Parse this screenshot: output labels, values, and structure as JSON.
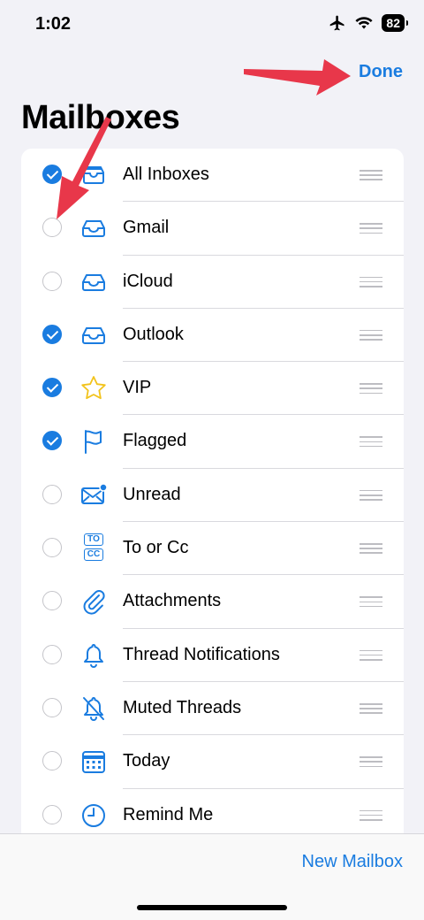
{
  "status_bar": {
    "time": "1:02",
    "battery": "82"
  },
  "header": {
    "done_label": "Done",
    "title": "Mailboxes"
  },
  "mailboxes": [
    {
      "label": "All Inboxes",
      "checked": true,
      "icon": "inbox-stack-icon"
    },
    {
      "label": "Gmail",
      "checked": false,
      "icon": "inbox-tray-icon"
    },
    {
      "label": "iCloud",
      "checked": false,
      "icon": "inbox-tray-icon"
    },
    {
      "label": "Outlook",
      "checked": true,
      "icon": "inbox-tray-icon"
    },
    {
      "label": "VIP",
      "checked": true,
      "icon": "star-icon"
    },
    {
      "label": "Flagged",
      "checked": true,
      "icon": "flag-icon"
    },
    {
      "label": "Unread",
      "checked": false,
      "icon": "unread-envelope-icon"
    },
    {
      "label": "To or Cc",
      "checked": false,
      "icon": "to-cc-icon",
      "icon_text": [
        "TO",
        "CC"
      ]
    },
    {
      "label": "Attachments",
      "checked": false,
      "icon": "paperclip-icon"
    },
    {
      "label": "Thread Notifications",
      "checked": false,
      "icon": "bell-icon"
    },
    {
      "label": "Muted Threads",
      "checked": false,
      "icon": "bell-slash-icon"
    },
    {
      "label": "Today",
      "checked": false,
      "icon": "calendar-icon"
    },
    {
      "label": "Remind Me",
      "checked": false,
      "icon": "clock-icon"
    }
  ],
  "footer": {
    "new_mailbox_label": "New Mailbox"
  },
  "colors": {
    "accent": "#1A7CE0",
    "star": "#F2C31B",
    "arrow": "#E8374A",
    "background": "#F2F2F7"
  }
}
